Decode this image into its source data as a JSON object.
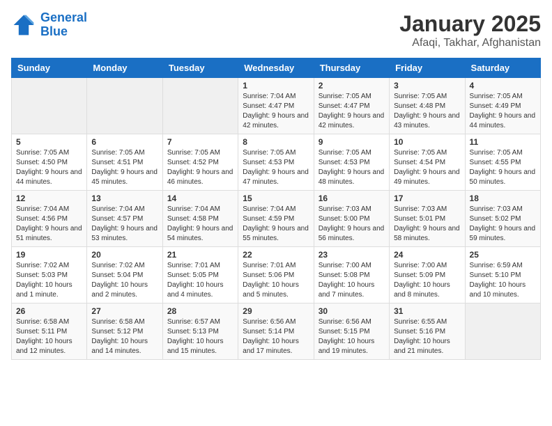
{
  "logo": {
    "text_general": "General",
    "text_blue": "Blue"
  },
  "title": "January 2025",
  "subtitle": "Afaqi, Takhar, Afghanistan",
  "weekdays": [
    "Sunday",
    "Monday",
    "Tuesday",
    "Wednesday",
    "Thursday",
    "Friday",
    "Saturday"
  ],
  "weeks": [
    [
      {
        "day": "",
        "info": ""
      },
      {
        "day": "",
        "info": ""
      },
      {
        "day": "",
        "info": ""
      },
      {
        "day": "1",
        "info": "Sunrise: 7:04 AM\nSunset: 4:47 PM\nDaylight: 9 hours and 42 minutes."
      },
      {
        "day": "2",
        "info": "Sunrise: 7:05 AM\nSunset: 4:47 PM\nDaylight: 9 hours and 42 minutes."
      },
      {
        "day": "3",
        "info": "Sunrise: 7:05 AM\nSunset: 4:48 PM\nDaylight: 9 hours and 43 minutes."
      },
      {
        "day": "4",
        "info": "Sunrise: 7:05 AM\nSunset: 4:49 PM\nDaylight: 9 hours and 44 minutes."
      }
    ],
    [
      {
        "day": "5",
        "info": "Sunrise: 7:05 AM\nSunset: 4:50 PM\nDaylight: 9 hours and 44 minutes."
      },
      {
        "day": "6",
        "info": "Sunrise: 7:05 AM\nSunset: 4:51 PM\nDaylight: 9 hours and 45 minutes."
      },
      {
        "day": "7",
        "info": "Sunrise: 7:05 AM\nSunset: 4:52 PM\nDaylight: 9 hours and 46 minutes."
      },
      {
        "day": "8",
        "info": "Sunrise: 7:05 AM\nSunset: 4:53 PM\nDaylight: 9 hours and 47 minutes."
      },
      {
        "day": "9",
        "info": "Sunrise: 7:05 AM\nSunset: 4:53 PM\nDaylight: 9 hours and 48 minutes."
      },
      {
        "day": "10",
        "info": "Sunrise: 7:05 AM\nSunset: 4:54 PM\nDaylight: 9 hours and 49 minutes."
      },
      {
        "day": "11",
        "info": "Sunrise: 7:05 AM\nSunset: 4:55 PM\nDaylight: 9 hours and 50 minutes."
      }
    ],
    [
      {
        "day": "12",
        "info": "Sunrise: 7:04 AM\nSunset: 4:56 PM\nDaylight: 9 hours and 51 minutes."
      },
      {
        "day": "13",
        "info": "Sunrise: 7:04 AM\nSunset: 4:57 PM\nDaylight: 9 hours and 53 minutes."
      },
      {
        "day": "14",
        "info": "Sunrise: 7:04 AM\nSunset: 4:58 PM\nDaylight: 9 hours and 54 minutes."
      },
      {
        "day": "15",
        "info": "Sunrise: 7:04 AM\nSunset: 4:59 PM\nDaylight: 9 hours and 55 minutes."
      },
      {
        "day": "16",
        "info": "Sunrise: 7:03 AM\nSunset: 5:00 PM\nDaylight: 9 hours and 56 minutes."
      },
      {
        "day": "17",
        "info": "Sunrise: 7:03 AM\nSunset: 5:01 PM\nDaylight: 9 hours and 58 minutes."
      },
      {
        "day": "18",
        "info": "Sunrise: 7:03 AM\nSunset: 5:02 PM\nDaylight: 9 hours and 59 minutes."
      }
    ],
    [
      {
        "day": "19",
        "info": "Sunrise: 7:02 AM\nSunset: 5:03 PM\nDaylight: 10 hours and 1 minute."
      },
      {
        "day": "20",
        "info": "Sunrise: 7:02 AM\nSunset: 5:04 PM\nDaylight: 10 hours and 2 minutes."
      },
      {
        "day": "21",
        "info": "Sunrise: 7:01 AM\nSunset: 5:05 PM\nDaylight: 10 hours and 4 minutes."
      },
      {
        "day": "22",
        "info": "Sunrise: 7:01 AM\nSunset: 5:06 PM\nDaylight: 10 hours and 5 minutes."
      },
      {
        "day": "23",
        "info": "Sunrise: 7:00 AM\nSunset: 5:08 PM\nDaylight: 10 hours and 7 minutes."
      },
      {
        "day": "24",
        "info": "Sunrise: 7:00 AM\nSunset: 5:09 PM\nDaylight: 10 hours and 8 minutes."
      },
      {
        "day": "25",
        "info": "Sunrise: 6:59 AM\nSunset: 5:10 PM\nDaylight: 10 hours and 10 minutes."
      }
    ],
    [
      {
        "day": "26",
        "info": "Sunrise: 6:58 AM\nSunset: 5:11 PM\nDaylight: 10 hours and 12 minutes."
      },
      {
        "day": "27",
        "info": "Sunrise: 6:58 AM\nSunset: 5:12 PM\nDaylight: 10 hours and 14 minutes."
      },
      {
        "day": "28",
        "info": "Sunrise: 6:57 AM\nSunset: 5:13 PM\nDaylight: 10 hours and 15 minutes."
      },
      {
        "day": "29",
        "info": "Sunrise: 6:56 AM\nSunset: 5:14 PM\nDaylight: 10 hours and 17 minutes."
      },
      {
        "day": "30",
        "info": "Sunrise: 6:56 AM\nSunset: 5:15 PM\nDaylight: 10 hours and 19 minutes."
      },
      {
        "day": "31",
        "info": "Sunrise: 6:55 AM\nSunset: 5:16 PM\nDaylight: 10 hours and 21 minutes."
      },
      {
        "day": "",
        "info": ""
      }
    ]
  ]
}
